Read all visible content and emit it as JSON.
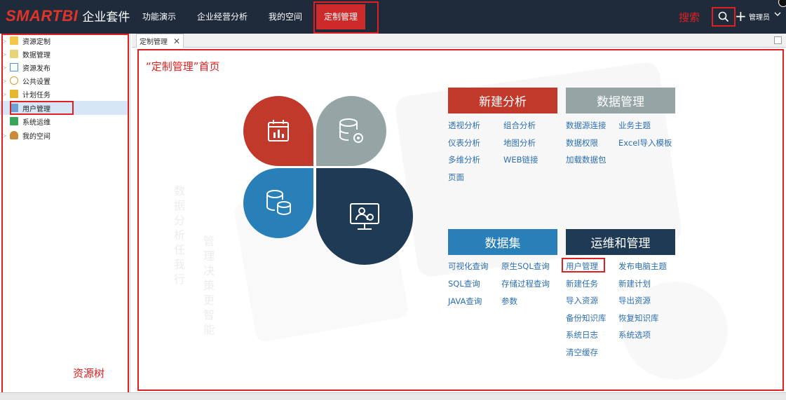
{
  "header": {
    "brand": "SMARTBI",
    "product": "企业套件",
    "nav": [
      "功能演示",
      "企业经营分析",
      "我的空间",
      "定制管理"
    ],
    "search_annotation": "搜索",
    "user": "管理员"
  },
  "tree": {
    "items": [
      {
        "label": "资源定制",
        "icon_color": "#f4c64a"
      },
      {
        "label": "数据管理",
        "icon_color": "#e8d27a"
      },
      {
        "label": "资源发布",
        "icon_color": "#4c8fd6"
      },
      {
        "label": "公共设置",
        "icon_color": "#d89a2c"
      },
      {
        "label": "计划任务",
        "icon_color": "#e6b830"
      },
      {
        "label": "用户管理",
        "icon_color": "#6f9ed4"
      },
      {
        "label": "系统运维",
        "icon_color": "#3aa55a"
      },
      {
        "label": "我的空间",
        "icon_color": "#c98a3a"
      }
    ],
    "selected": "用户管理",
    "annotation": "资源树"
  },
  "tabs": {
    "active": "定制管理"
  },
  "content": {
    "annotation": "“定制管理”首页",
    "sections": {
      "new_analysis": {
        "title": "新建分析",
        "color": "#c0392b",
        "links": [
          "透视分析",
          "组合分析",
          "仪表分析",
          "地图分析",
          "多维分析",
          "WEB链接",
          "页面"
        ]
      },
      "data_management": {
        "title": "数据管理",
        "color": "#95a5a6",
        "links": [
          "数据源连接",
          "业务主题",
          "数据权限",
          "Excel导入模板",
          "加载数据包"
        ]
      },
      "dataset": {
        "title": "数据集",
        "color": "#2980b9",
        "links": [
          "可视化查询",
          "原生SQL查询",
          "SQL查询",
          "存储过程查询",
          "JAVA查询",
          "参数"
        ]
      },
      "ops": {
        "title": "运维和管理",
        "color": "#1e3a54",
        "links": [
          "用户管理",
          "发布电脑主题",
          "新建任务",
          "新建计划",
          "导入资源",
          "导出资源",
          "备份知识库",
          "恢复知识库",
          "系统日志",
          "系统选项",
          "清空缓存"
        ]
      }
    },
    "watermark_1": "数据分析任我行",
    "watermark_2": "管理决策更智能"
  }
}
